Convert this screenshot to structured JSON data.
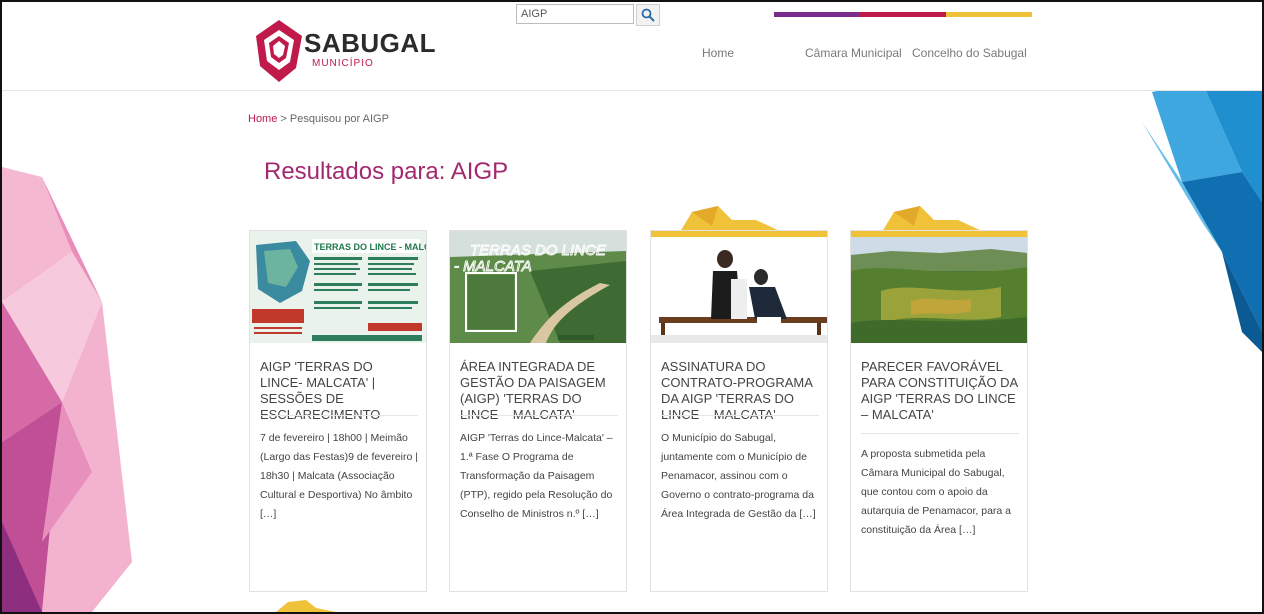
{
  "search": {
    "value": "AIGP"
  },
  "logo": {
    "name": "SABUGAL",
    "subtitle": "MUNICÍPIO"
  },
  "nav": {
    "items": [
      "Home",
      "Câmara Municipal",
      "Concelho do Sabugal"
    ]
  },
  "breadcrumb": {
    "home": "Home",
    "current": " > Pesquisou por AIGP"
  },
  "results": {
    "title": "Resultados para: AIGP"
  },
  "colors": {
    "brand": "#c01a4b",
    "title": "#a3296f",
    "ribbon": "#f0c23a"
  },
  "cards": [
    {
      "title": "AIGP 'TERRAS DO LINCE- MALCATA' | SESSÕES DE ESCLARECIMENTO",
      "excerpt": "7 de fevereiro | 18h00 | Meimão (Largo das Festas)9 de fevereiro | 18h30 | Malcata (Associação Cultural e Desportiva) No âmbito […]",
      "image_text": "TERRAS DO LINCE - MALCATA"
    },
    {
      "title": "ÁREA INTEGRADA DE GESTÃO DA PAISAGEM (AIGP) 'TERRAS DO LINCE – MALCATA'",
      "excerpt": "AIGP 'Terras do Lince-Malcata' – 1.ª Fase O Programa de Transformação da Paisagem (PTP), regido pela Resolução do Conselho de Ministros n.º […]",
      "image_text": "TERRAS DO LINCE - MALCATA"
    },
    {
      "title": "ASSINATURA DO CONTRATO-PROGRAMA DA AIGP 'TERRAS DO LINCE – MALCATA'",
      "excerpt": "O Município do Sabugal, juntamente com o Município de Penamacor, assinou com o Governo o contrato-programa da Área Integrada de Gestão da […]"
    },
    {
      "title": "PARECER FAVORÁVEL PARA CONSTITUIÇÃO DA AIGP 'TERRAS DO LINCE – MALCATA'",
      "excerpt": "A proposta submetida pela Câmara Municipal do Sabugal, que contou com o apoio da autarquia de Penamacor, para a constituição da Área […]"
    }
  ]
}
